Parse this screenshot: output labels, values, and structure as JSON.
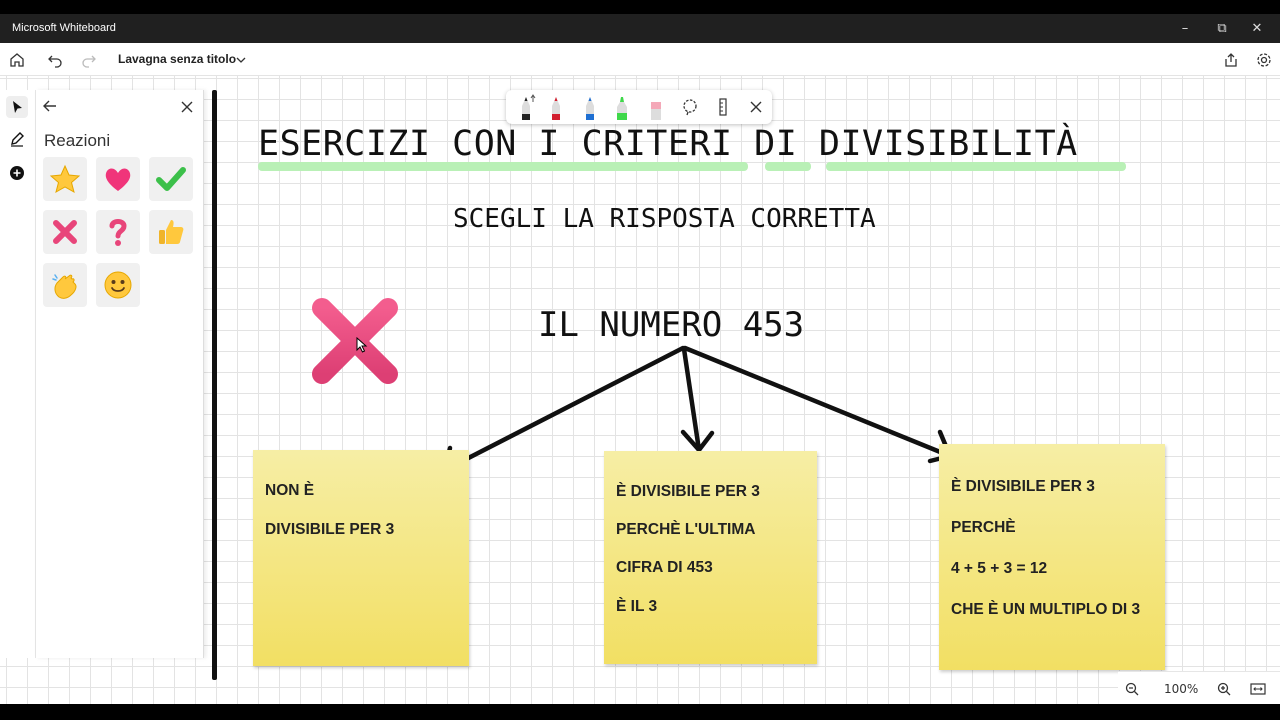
{
  "window": {
    "title": "Microsoft Whiteboard"
  },
  "toolbar": {
    "doc_title": "Lavagna senza titolo"
  },
  "panel": {
    "title": "Reazioni",
    "reactions": [
      "star",
      "heart",
      "checkmark",
      "cross",
      "question",
      "thumbs-up",
      "clapping",
      "smiley"
    ]
  },
  "board": {
    "heading": "ESERCIZI CON I CRITERI DI DIVISIBILITÀ",
    "subheading": "SCEGLI LA RISPOSTA CORRETTA",
    "number_label": "IL NUMERO 453",
    "notes": [
      {
        "lines": [
          "NON È",
          "DIVISIBILE PER 3"
        ]
      },
      {
        "lines": [
          "È DIVISIBILE PER 3",
          "PERCHÈ L'ULTIMA",
          "CIFRA DI 453",
          "È IL 3"
        ]
      },
      {
        "lines": [
          "È DIVISIBILE PER 3",
          "PERCHÈ",
          "4 + 5 + 3 = 12",
          "CHE È UN MULTIPLO DI 3"
        ]
      }
    ]
  },
  "zoom": {
    "level": "100%"
  },
  "colors": {
    "note": "#f2df63",
    "highlight": "#b9f0b6",
    "cross": "#e8457a"
  }
}
